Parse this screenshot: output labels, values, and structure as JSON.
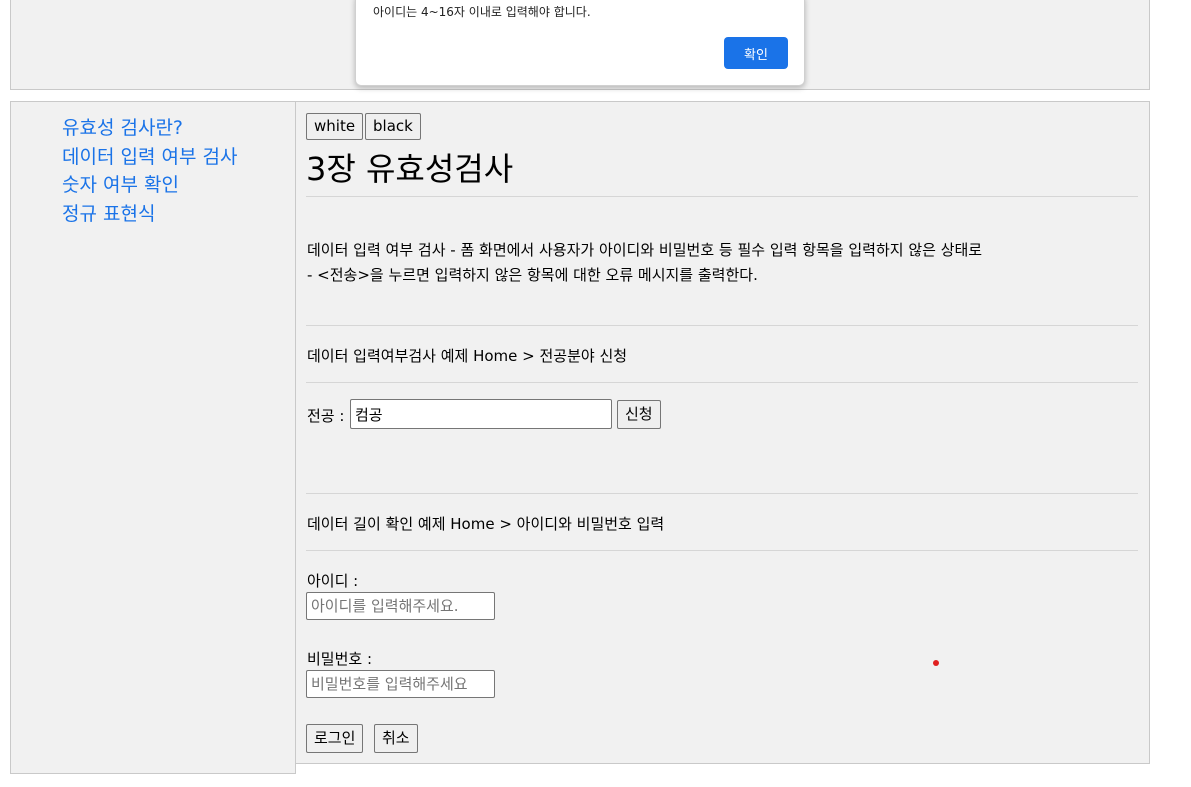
{
  "dialog": {
    "message": "아이디는 4~16자 이내로 입력해야 합니다.",
    "ok_label": "확인"
  },
  "sidebar": {
    "items": [
      {
        "label": "유효성 검사란?"
      },
      {
        "label": "데이터 입력 여부 검사"
      },
      {
        "label": "숫자 여부 확인"
      },
      {
        "label": "정규 표현식"
      }
    ],
    "link_color": "#1a73e8"
  },
  "theme_buttons": {
    "white_label": "white",
    "black_label": "black"
  },
  "main": {
    "title": "3장 유효성검사",
    "description_line1": "데이터 입력 여부 검사 - 폼 화면에서 사용자가 아이디와 비밀번호 등 필수 입력 항목을 입력하지 않은 상태로",
    "description_line2": "- <전송>을 누르면 입력하지 않은 항목에 대한 오류 메시지를 출력한다.",
    "example1": {
      "heading": "데이터 입력여부검사 예제 Home > 전공분야 신청",
      "major_label": "전공 :",
      "major_value": "컴공",
      "submit_label": "신청"
    },
    "example2": {
      "heading": "데이터 길이 확인 예제 Home > 아이디와 비밀번호 입력",
      "id_label": "아이디 :",
      "id_placeholder": "아이디를 입력해주세요.",
      "pw_label": "비밀번호 :",
      "pw_placeholder": "비밀번호를 입력해주세요",
      "login_label": "로그인",
      "cancel_label": "취소"
    }
  }
}
